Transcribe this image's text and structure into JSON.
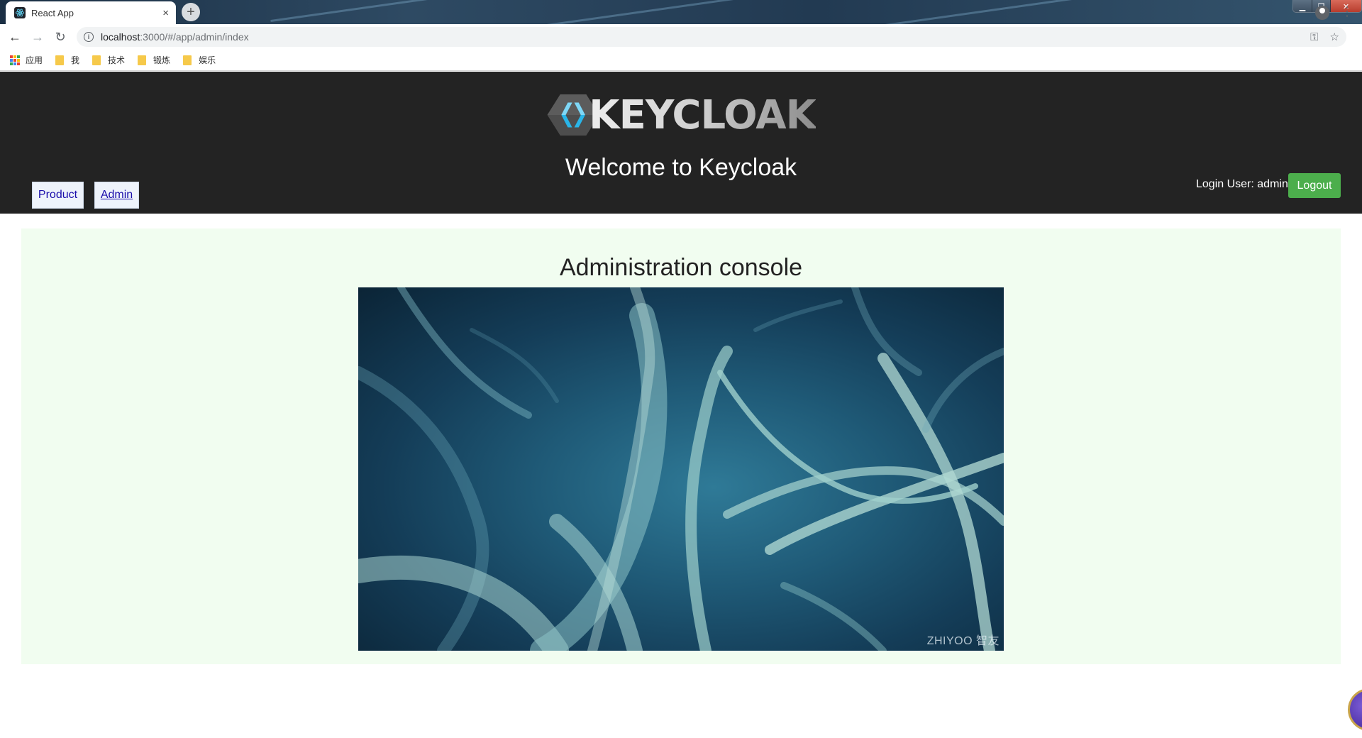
{
  "browser": {
    "tab_title": "React App",
    "tab_close": "×",
    "new_tab": "+",
    "window_controls": {
      "minimize": "▁",
      "restore": "❐",
      "close": "✕"
    },
    "nav": {
      "back": "←",
      "forward": "→",
      "reload": "↻"
    },
    "url_host": "localhost",
    "url_path": ":3000/#/app/admin/index",
    "omnibox_icons": {
      "key": "⚿",
      "star": "☆"
    },
    "menu": "⋮",
    "bookmarks": [
      {
        "label": "应用",
        "type": "apps"
      },
      {
        "label": "我",
        "type": "folder"
      },
      {
        "label": "技术",
        "type": "folder"
      },
      {
        "label": "锻炼",
        "type": "folder"
      },
      {
        "label": "娱乐",
        "type": "folder"
      }
    ]
  },
  "header": {
    "logo_text": "KEYCLOAK",
    "welcome": "Welcome to Keycloak",
    "nav": {
      "product": "Product",
      "admin": "Admin"
    },
    "login_user": "Login User: admin",
    "logout": "Logout",
    "colors": {
      "background": "#232323",
      "logout": "#4cae4c",
      "logo_accent": "#29b5e8"
    }
  },
  "main": {
    "title": "Administration console",
    "image_watermark": "ZHIYOO 智友",
    "panel_color": "#f1fdf0"
  }
}
